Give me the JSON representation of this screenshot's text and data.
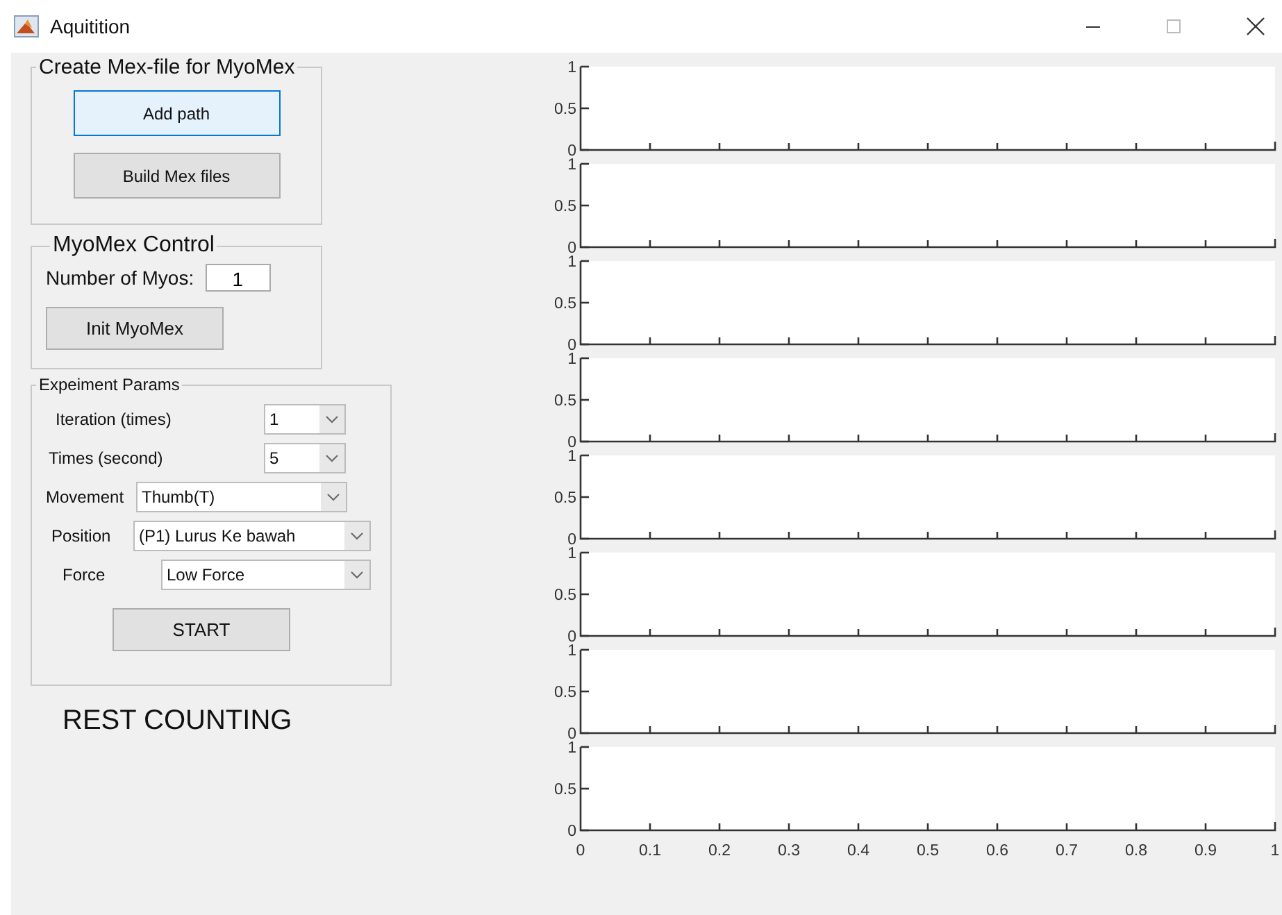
{
  "window": {
    "title": "Aquitition"
  },
  "mex_panel": {
    "title": "Create Mex-file for MyoMex",
    "buttons": [
      {
        "label": "Add path",
        "focused": true
      },
      {
        "label": "Build Mex files",
        "focused": false
      }
    ]
  },
  "control_panel": {
    "title": "MyoMex Control",
    "number_label": "Number of Myos:",
    "number_value": "1",
    "button": "Init MyoMex"
  },
  "params_panel": {
    "title": "Expeiment Params",
    "fields": [
      {
        "label": "Iteration (times)",
        "value": "1"
      },
      {
        "label": "Times (second)",
        "value": "5"
      },
      {
        "label": "Movement",
        "value": "Thumb(T)"
      },
      {
        "label": "Position",
        "value": "(P1) Lurus Ke bawah"
      },
      {
        "label": "Force",
        "value": "Low Force"
      }
    ],
    "button": "START"
  },
  "status": "REST COUNTING",
  "axes": [
    {
      "yticks": [
        "1",
        "0.5",
        "0"
      ]
    },
    {
      "yticks": [
        "1",
        "0.5",
        "0"
      ]
    },
    {
      "yticks": [
        "1",
        "0.5",
        "0"
      ]
    },
    {
      "yticks": [
        "1",
        "0.5",
        "0"
      ]
    },
    {
      "yticks": [
        "1",
        "0.5",
        "0"
      ]
    },
    {
      "yticks": [
        "1",
        "0.5",
        "0"
      ]
    },
    {
      "yticks": [
        "1",
        "0.5",
        "0"
      ]
    },
    {
      "yticks": [
        "1",
        "0.5",
        "0"
      ],
      "xticks": [
        "0",
        "0.1",
        "0.2",
        "0.3",
        "0.4",
        "0.5",
        "0.6",
        "0.7",
        "0.8",
        "0.9",
        "1"
      ]
    }
  ]
}
